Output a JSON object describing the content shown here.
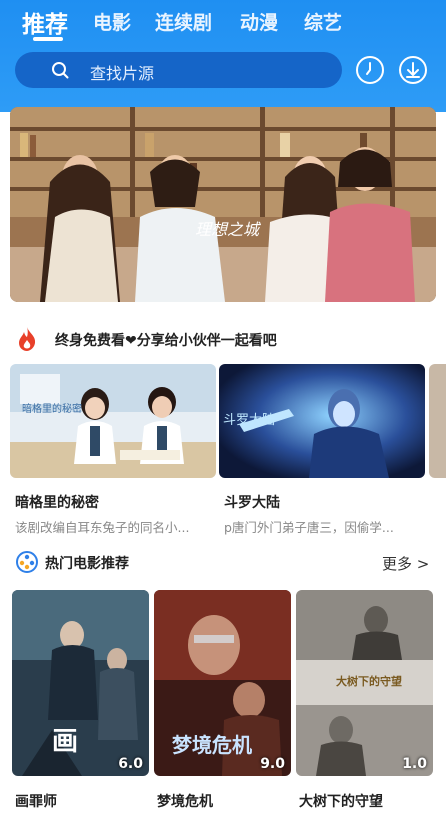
{
  "tabs": [
    {
      "label": "推荐",
      "active": true
    },
    {
      "label": "电影",
      "active": false
    },
    {
      "label": "连续剧",
      "active": false
    },
    {
      "label": "动漫",
      "active": false
    },
    {
      "label": "综艺",
      "active": false
    }
  ],
  "search": {
    "placeholder": "查找片源"
  },
  "header_icons": [
    "history-clock-icon",
    "download-icon"
  ],
  "banner": {
    "title_art": "理想之城"
  },
  "promo": {
    "text": "终身免费看❤分享给小伙伴一起看吧",
    "icon": "fire-icon"
  },
  "recommended": [
    {
      "title": "暗格里的秘密",
      "desc": "该剧改编自耳东兔子的同名小..."
    },
    {
      "title": "斗罗大陆",
      "desc": "p唐门外门弟子唐三，因偷学..."
    }
  ],
  "hot_movies": {
    "heading": "热门电影推荐",
    "more": "更多 >",
    "items": [
      {
        "title": "画罪师",
        "score": "6.0"
      },
      {
        "title": "梦境危机",
        "score": "9.0"
      },
      {
        "title": "大树下的守望",
        "score": "1.0"
      }
    ]
  },
  "colors": {
    "header_blue": "#1f8ff2",
    "search_bg": "#1565c8",
    "fire": "#e8402a"
  }
}
